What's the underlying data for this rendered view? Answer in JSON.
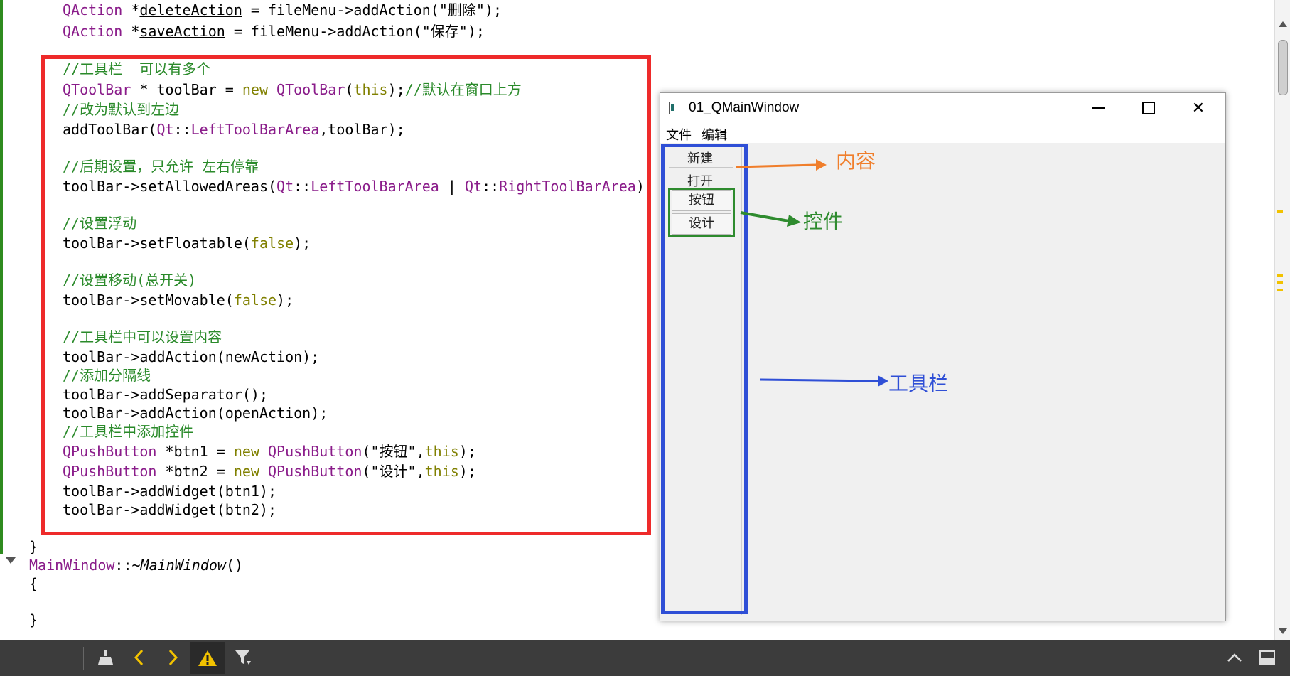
{
  "editor": {
    "lines": [
      {
        "id": "l1",
        "parts": [
          {
            "text": "QAction",
            "c": "t"
          },
          {
            "text": " *"
          },
          {
            "text": "deleteAction",
            "c": "u"
          },
          {
            "text": " = fileMenu->addAction(\"删除\");"
          }
        ]
      },
      {
        "id": "l2",
        "parts": [
          {
            "text": "QAction",
            "c": "t"
          },
          {
            "text": " *"
          },
          {
            "text": "saveAction",
            "c": "u"
          },
          {
            "text": " = fileMenu->addAction(\"保存\");"
          }
        ]
      },
      {
        "id": "l3",
        "parts": [
          {
            "text": "//工具栏  可以有多个",
            "c": "c"
          }
        ]
      },
      {
        "id": "l4",
        "parts": [
          {
            "text": "QToolBar",
            "c": "t"
          },
          {
            "text": " * toolBar = "
          },
          {
            "text": "new",
            "c": "k"
          },
          {
            "text": " "
          },
          {
            "text": "QToolBar",
            "c": "t"
          },
          {
            "text": "("
          },
          {
            "text": "this",
            "c": "k"
          },
          {
            "text": ");"
          },
          {
            "text": "//默认在窗口上方",
            "c": "c"
          }
        ]
      },
      {
        "id": "l5",
        "parts": [
          {
            "text": "//改为默认到左边",
            "c": "c"
          }
        ]
      },
      {
        "id": "l6",
        "parts": [
          {
            "text": "addToolBar("
          },
          {
            "text": "Qt",
            "c": "t"
          },
          {
            "text": "::"
          },
          {
            "text": "LeftToolBarArea",
            "c": "t"
          },
          {
            "text": ",toolBar);"
          }
        ]
      },
      {
        "id": "l7",
        "parts": [
          {
            "text": "//后期设置，只允许 左右停靠",
            "c": "c"
          }
        ]
      },
      {
        "id": "l8",
        "parts": [
          {
            "text": "toolBar->setAllowedAreas("
          },
          {
            "text": "Qt",
            "c": "t"
          },
          {
            "text": "::"
          },
          {
            "text": "LeftToolBarArea",
            "c": "t"
          },
          {
            "text": " | "
          },
          {
            "text": "Qt",
            "c": "t"
          },
          {
            "text": "::"
          },
          {
            "text": "RightToolBarArea",
            "c": "t"
          },
          {
            "text": ");"
          }
        ]
      },
      {
        "id": "l9",
        "parts": [
          {
            "text": "//设置浮动",
            "c": "c"
          }
        ]
      },
      {
        "id": "l10",
        "parts": [
          {
            "text": "toolBar->setFloatable("
          },
          {
            "text": "false",
            "c": "k"
          },
          {
            "text": ");"
          }
        ]
      },
      {
        "id": "l11",
        "parts": [
          {
            "text": "//设置移动(总开关)",
            "c": "c"
          }
        ]
      },
      {
        "id": "l12",
        "parts": [
          {
            "text": "toolBar->setMovable("
          },
          {
            "text": "false",
            "c": "k"
          },
          {
            "text": ");"
          }
        ]
      },
      {
        "id": "l13",
        "parts": [
          {
            "text": "//工具栏中可以设置内容",
            "c": "c"
          }
        ]
      },
      {
        "id": "l14",
        "parts": [
          {
            "text": "toolBar->addAction(newAction);"
          }
        ]
      },
      {
        "id": "l15",
        "parts": [
          {
            "text": "//添加分隔线",
            "c": "c"
          }
        ]
      },
      {
        "id": "l16",
        "parts": [
          {
            "text": "toolBar->addSeparator();"
          }
        ]
      },
      {
        "id": "l17",
        "parts": [
          {
            "text": "toolBar->addAction(openAction);"
          }
        ]
      },
      {
        "id": "l18",
        "parts": [
          {
            "text": "//工具栏中添加控件",
            "c": "c"
          }
        ]
      },
      {
        "id": "l19",
        "parts": [
          {
            "text": "QPushButton",
            "c": "t"
          },
          {
            "text": " *btn1 = "
          },
          {
            "text": "new",
            "c": "k"
          },
          {
            "text": " "
          },
          {
            "text": "QPushButton",
            "c": "t"
          },
          {
            "text": "(\"按钮\","
          },
          {
            "text": "this",
            "c": "k"
          },
          {
            "text": ");"
          }
        ]
      },
      {
        "id": "l20",
        "parts": [
          {
            "text": "QPushButton",
            "c": "t"
          },
          {
            "text": " *btn2 = "
          },
          {
            "text": "new",
            "c": "k"
          },
          {
            "text": " "
          },
          {
            "text": "QPushButton",
            "c": "t"
          },
          {
            "text": "(\"设计\","
          },
          {
            "text": "this",
            "c": "k"
          },
          {
            "text": ");"
          }
        ]
      },
      {
        "id": "l21",
        "parts": [
          {
            "text": "toolBar->addWidget(btn1);"
          }
        ]
      },
      {
        "id": "l22",
        "parts": [
          {
            "text": "toolBar->addWidget(btn2);"
          }
        ]
      },
      {
        "id": "l23",
        "parts": [
          {
            "text": "}"
          }
        ]
      },
      {
        "id": "l24",
        "parts": [
          {
            "text": "MainWindow",
            "c": "t"
          },
          {
            "text": "::"
          },
          {
            "text": "~MainWindow",
            "c": "i"
          },
          {
            "text": "()"
          }
        ]
      },
      {
        "id": "l25",
        "parts": [
          {
            "text": "{"
          }
        ]
      },
      {
        "id": "l26",
        "parts": [
          {
            "text": "}"
          }
        ]
      }
    ]
  },
  "qt_window": {
    "title": "01_QMainWindow",
    "menus": [
      "文件",
      "编辑"
    ],
    "toolbar": {
      "actions": [
        "新建",
        "打开"
      ],
      "buttons": [
        "按钮",
        "设计"
      ]
    }
  },
  "annotations": {
    "content": {
      "text": "内容",
      "color": "#f07e2b"
    },
    "widget": {
      "text": "控件",
      "color": "#2e8b2e"
    },
    "toolbar": {
      "text": "工具栏",
      "color": "#2f4fd6"
    }
  },
  "colors": {
    "highlight_box": "#ee2a2a",
    "type_color": "#8a1c8a",
    "keyword_color": "#808000",
    "comment_color": "#2a8a2a"
  },
  "bottom_bar": {
    "icons": [
      "broom-icon",
      "chevron-left-icon",
      "chevron-right-icon",
      "warning-icon",
      "filter-icon",
      "chevron-up-icon",
      "panel-icon"
    ]
  }
}
